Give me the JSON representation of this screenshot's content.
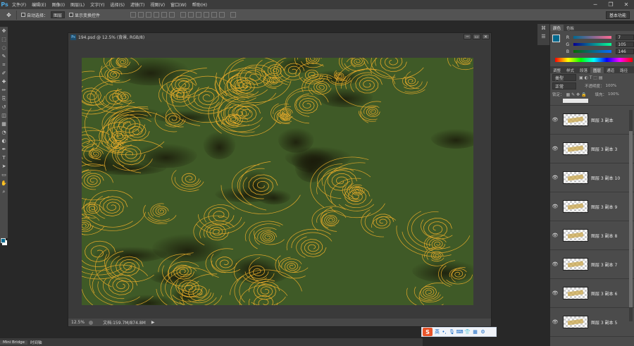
{
  "app": {
    "logo": "Ps"
  },
  "menu": [
    "文件(F)",
    "编辑(E)",
    "图像(I)",
    "图层(L)",
    "文字(Y)",
    "选择(S)",
    "滤镜(T)",
    "视图(V)",
    "窗口(W)",
    "帮助(H)"
  ],
  "window_controls": {
    "minimize": "─",
    "restore": "❐",
    "close": "✕"
  },
  "options_bar": {
    "tool_icon": "move-tool-icon",
    "auto_select_label": "自动选择：",
    "auto_select_value": "图层",
    "show_transform_label": "显示变换控件",
    "workspace": "基本功能"
  },
  "toolbar": {
    "tools": [
      "move-tool-icon",
      "marquee-tool-icon",
      "lasso-tool-icon",
      "quick-select-tool-icon",
      "crop-tool-icon",
      "eyedropper-tool-icon",
      "healing-brush-icon",
      "brush-tool-icon",
      "clone-stamp-icon",
      "history-brush-icon",
      "eraser-tool-icon",
      "gradient-tool-icon",
      "blur-tool-icon",
      "dodge-tool-icon",
      "pen-tool-icon",
      "type-tool-icon",
      "path-select-icon",
      "shape-tool-icon",
      "hand-tool-icon",
      "zoom-tool-icon"
    ],
    "glyphs": [
      "✥",
      "⬚",
      "◌",
      "✎",
      "⌗",
      "✐",
      "✚",
      "✏",
      "⎘",
      "↺",
      "◫",
      "▦",
      "◔",
      "◐",
      "✒",
      "T",
      "➤",
      "▭",
      "✋",
      "⌕"
    ],
    "foreground_color": "#00698e",
    "background_color": "#ffffff"
  },
  "document": {
    "title": "194.psd @ 12.5% (背景, RGB/8)",
    "zoom": "12.5%",
    "doc_info": "文档:159.7M/874.8M",
    "canvas_color": "#3f5a27",
    "line_color": "#e2a82a"
  },
  "color_panel": {
    "tabs": [
      "颜色",
      "色板"
    ],
    "r": {
      "label": "R",
      "value": "7"
    },
    "g": {
      "label": "G",
      "value": "105"
    },
    "b": {
      "label": "B",
      "value": "146"
    }
  },
  "layers_panel": {
    "tabs": [
      "调整",
      "样式",
      "段落",
      "图层",
      "通道",
      "路径"
    ],
    "filter": "类型",
    "blend_mode": "正常",
    "opacity_label": "不透明度：",
    "opacity_value": "100%",
    "lock_label": "锁定：",
    "fill_label": "填充：",
    "fill_value": "100%",
    "layers": [
      "图层 3 副本",
      "图层 3 副本 3",
      "图层 3 副本 10",
      "图层 3 副本 9",
      "图层 3 副本 8",
      "图层 3 副本 7",
      "图层 3 副本 6",
      "图层 3 副本 5"
    ]
  },
  "bottom_tabs": [
    "Mini Bridge",
    "时间轴"
  ],
  "ime": {
    "logo": "S",
    "lang": "英"
  }
}
